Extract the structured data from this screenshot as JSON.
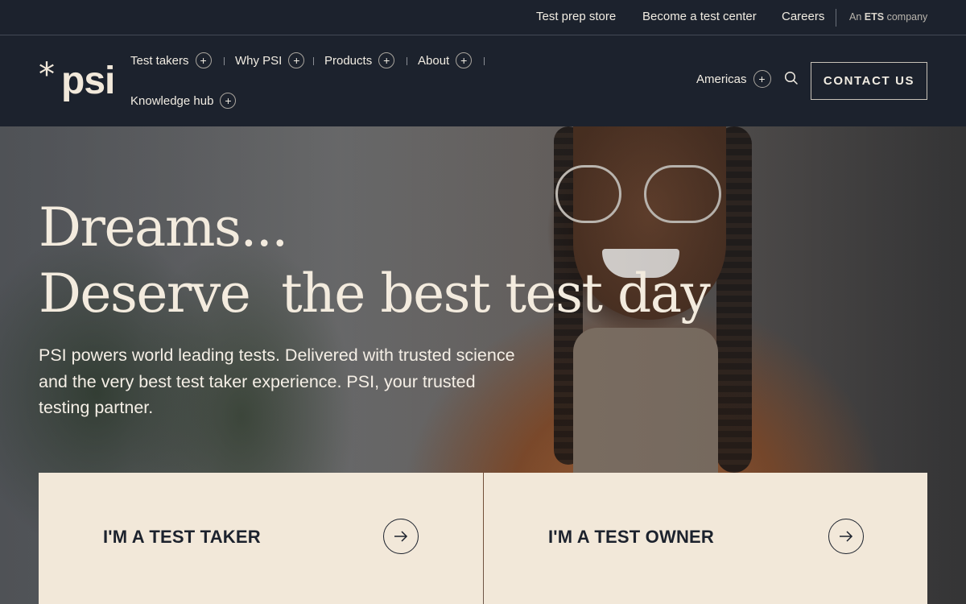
{
  "utility_nav": {
    "links": [
      {
        "label": "Test prep store"
      },
      {
        "label": "Become a test center"
      },
      {
        "label": "Careers"
      }
    ],
    "ets_prefix": "An",
    "ets_brand": "ETS",
    "ets_suffix": "company"
  },
  "logo": {
    "mark": "*",
    "text": "psi"
  },
  "main_nav": {
    "items": [
      {
        "label": "Test takers"
      },
      {
        "label": "Why PSI"
      },
      {
        "label": "Products"
      },
      {
        "label": "About"
      },
      {
        "label": "Knowledge hub"
      }
    ],
    "region": "Americas",
    "contact": "CONTACT US"
  },
  "hero": {
    "headline_line1": "Dreams...",
    "headline_line2": "Deserve  the best test day",
    "subtext": "PSI powers world leading tests. Delivered with trusted science and the very best test taker experience. PSI, your trusted testing partner."
  },
  "cards": {
    "taker": "I'M A TEST TAKER",
    "owner": "I'M A TEST OWNER"
  },
  "icons": {
    "plus": "plus-circle-icon",
    "search": "search-icon",
    "arrow": "arrow-right-icon"
  },
  "colors": {
    "nav_bg": "#1c222d",
    "cream": "#f2e8d9",
    "text_light": "#f1ece2"
  }
}
